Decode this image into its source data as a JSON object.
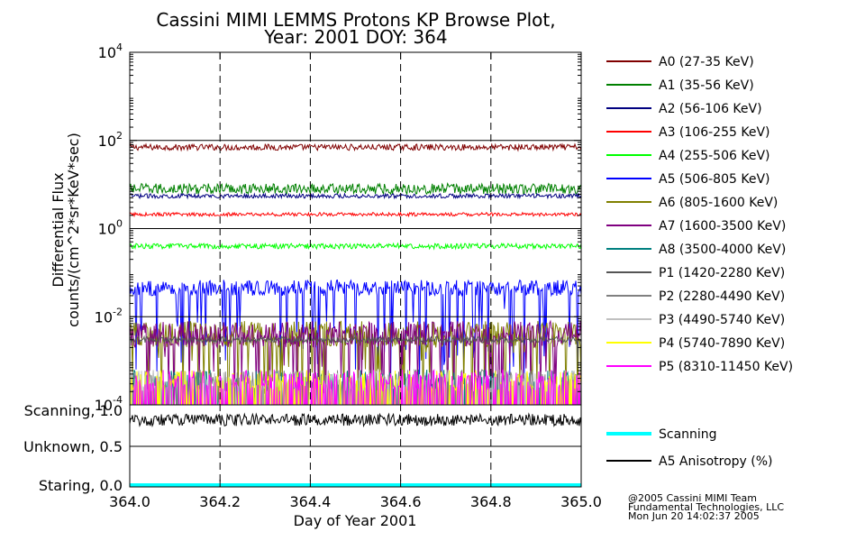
{
  "chart_data": {
    "type": "line",
    "title": "Cassini MIMI LEMMS Protons KP Browse Plot,",
    "subtitle": "Year: 2001 DOY: 364",
    "xlabel": "Day of Year 2001",
    "ylabel_line1": "Differential Flux",
    "ylabel_line2": "counts/(cm^2*sr*KeV*sec)",
    "xlim": [
      364.0,
      365.0
    ],
    "x_ticks": [
      "364.0",
      "364.2",
      "364.4",
      "364.6",
      "364.8",
      "365.0"
    ],
    "ylim": [
      0.0001,
      10000
    ],
    "y_scale": "log",
    "y_ticks": [
      {
        "base": "10",
        "exp": "4",
        "value": 10000
      },
      {
        "base": "10",
        "exp": "2",
        "value": 100
      },
      {
        "base": "10",
        "exp": "0",
        "value": 1
      },
      {
        "base": "10",
        "exp": "-2",
        "value": 0.01
      },
      {
        "base": "10",
        "exp": "-4",
        "value": 0.0001
      }
    ],
    "series": [
      {
        "name": "A0 (27-35 KeV)",
        "color": "#800000",
        "level": 70,
        "spread": 0.07,
        "style": "steady"
      },
      {
        "name": "A1 (35-56 KeV)",
        "color": "#008000",
        "level": 8,
        "spread": 0.12,
        "style": "steady"
      },
      {
        "name": "A2 (56-106 KeV)",
        "color": "#000080",
        "level": 5.5,
        "spread": 0.05,
        "style": "steady"
      },
      {
        "name": "A3 (106-255 KeV)",
        "color": "#ff0000",
        "level": 2.1,
        "spread": 0.04,
        "style": "steady"
      },
      {
        "name": "A4 (255-506 KeV)",
        "color": "#00ff00",
        "level": 0.4,
        "spread": 0.06,
        "style": "steady"
      },
      {
        "name": "A5 (506-805 KeV)",
        "color": "#0000ff",
        "level": 0.045,
        "spread": 0.18,
        "style": "dropouts"
      },
      {
        "name": "A6 (805-1600 KeV)",
        "color": "#808000",
        "level": 0.004,
        "spread": 0.3,
        "style": "dropouts"
      },
      {
        "name": "A7 (1600-3500 KeV)",
        "color": "#800080",
        "level": 0.004,
        "spread": 0.3,
        "style": "dropouts"
      },
      {
        "name": "A8 (3500-4000 KeV)",
        "color": "#008080",
        "level": 0.0002,
        "spread": 0.3,
        "style": "sparse"
      },
      {
        "name": "P1 (1420-2280 KeV)",
        "color": "#555555",
        "level": 0.003,
        "spread": 0.07,
        "style": "steady"
      },
      {
        "name": "P2 (2280-4490 KeV)",
        "color": "#808080",
        "level": 0.0002,
        "spread": 0.3,
        "style": "sparse"
      },
      {
        "name": "P3 (4490-5740 KeV)",
        "color": "#c0c0c0",
        "level": 0.0002,
        "spread": 0.3,
        "style": "sparse"
      },
      {
        "name": "P4 (5740-7890 KeV)",
        "color": "#ffff00",
        "level": 0.0002,
        "spread": 0.3,
        "style": "sparse"
      },
      {
        "name": "P5 (8310-11450 KeV)",
        "color": "#ff00ff",
        "level": 0.0002,
        "spread": 0.3,
        "style": "sparse"
      }
    ],
    "lower_panel": {
      "y_ticks": [
        "Scanning, 1.0",
        "Unknown, 0.5",
        "Staring, 0.0"
      ],
      "ylim": [
        0.0,
        1.0
      ],
      "series": [
        {
          "name": "Scanning",
          "color": "#00ffff",
          "value": 0.0
        },
        {
          "name": "A5 Anisotropy (%)",
          "color": "#000000",
          "level": 0.87,
          "spread": 0.08
        }
      ]
    },
    "grid": "dashed vertical lines at 364.2, 364.4, 364.6, 364.8",
    "legend_placement": "right"
  },
  "footer": {
    "line1": "@2005 Cassini MIMI Team",
    "line2": "Fundamental Technologies, LLC",
    "line3": "Mon Jun 20 14:02:37 2005"
  }
}
